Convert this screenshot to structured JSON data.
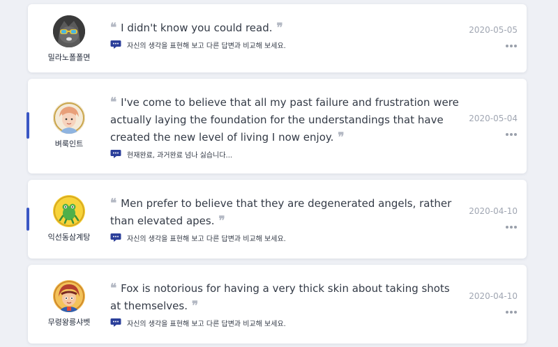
{
  "posts": [
    {
      "username": "밀라노폴폴면",
      "quote": "I didn't know you could read.",
      "comment": "자신의 생각을 표현해 보고 다른 답변과 비교해 보세요.",
      "date": "2020-05-05",
      "highlighted": false
    },
    {
      "username": "벼룩인트",
      "quote": "I've come to believe that all my past failure and frustration were actually laying the foundation for the understandings that have created the new level of living I now enjoy.",
      "comment": "현재완료, 과거완료 넘나 싫습니다...",
      "date": "2020-05-04",
      "highlighted": true
    },
    {
      "username": "익선동삼계탕",
      "quote": "Men prefer to believe that they are degenerated angels, rather than elevated apes.",
      "comment": "자신의 생각을 표현해 보고 다른 답변과 비교해 보세요.",
      "date": "2020-04-10",
      "highlighted": true
    },
    {
      "username": "무령왕릉샤벳",
      "quote": "Fox is notorious for having a very thick skin about taking shots at themselves.",
      "comment": "자신의 생각을 표현해 보고 다른 답변과 비교해 보세요.",
      "date": "2020-04-10",
      "highlighted": false
    }
  ],
  "quote_open_mark": "❝",
  "quote_close_mark": "❞",
  "colors": {
    "accent": "#3a57c4",
    "background": "#eef0f5",
    "text": "#333a46",
    "muted": "#a0a6b2"
  },
  "icons": {
    "comment": "chat-bubble-icon",
    "more": "ellipsis-icon"
  }
}
